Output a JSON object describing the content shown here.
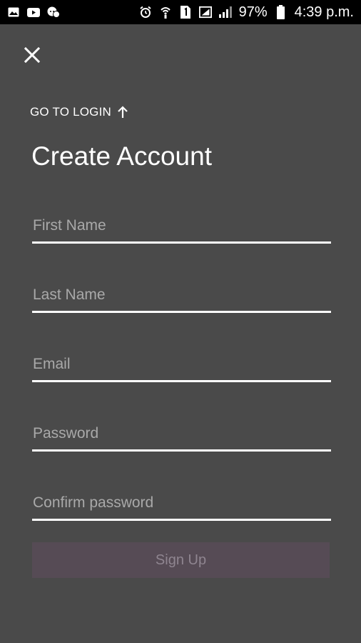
{
  "status_bar": {
    "battery_percent": "97%",
    "time": "4:39 p.m.",
    "left_icons": [
      "image-icon",
      "youtube-icon",
      "chat-icon"
    ],
    "right_icons": [
      "alarm-icon",
      "wifi-calling-icon",
      "sim-icon",
      "signal-box-icon",
      "signal-icon",
      "battery-icon"
    ]
  },
  "nav": {
    "close_icon": "close-icon",
    "go_to_login_label": "GO TO LOGIN",
    "go_to_login_icon": "arrow-up-icon"
  },
  "form": {
    "title": "Create Account",
    "fields": {
      "first_name": {
        "value": "",
        "placeholder": "First Name"
      },
      "last_name": {
        "value": "",
        "placeholder": "Last Name"
      },
      "email": {
        "value": "",
        "placeholder": "Email"
      },
      "password": {
        "value": "",
        "placeholder": "Password"
      },
      "confirm_password": {
        "value": "",
        "placeholder": "Confirm password"
      }
    },
    "submit_label": "Sign Up",
    "submit_enabled": false
  },
  "colors": {
    "background": "#4a4a4a",
    "status_bar": "#000000",
    "text": "#ffffff",
    "placeholder": "#a9a9a9",
    "button_bg": "#564b55",
    "button_text": "#8f8590"
  }
}
